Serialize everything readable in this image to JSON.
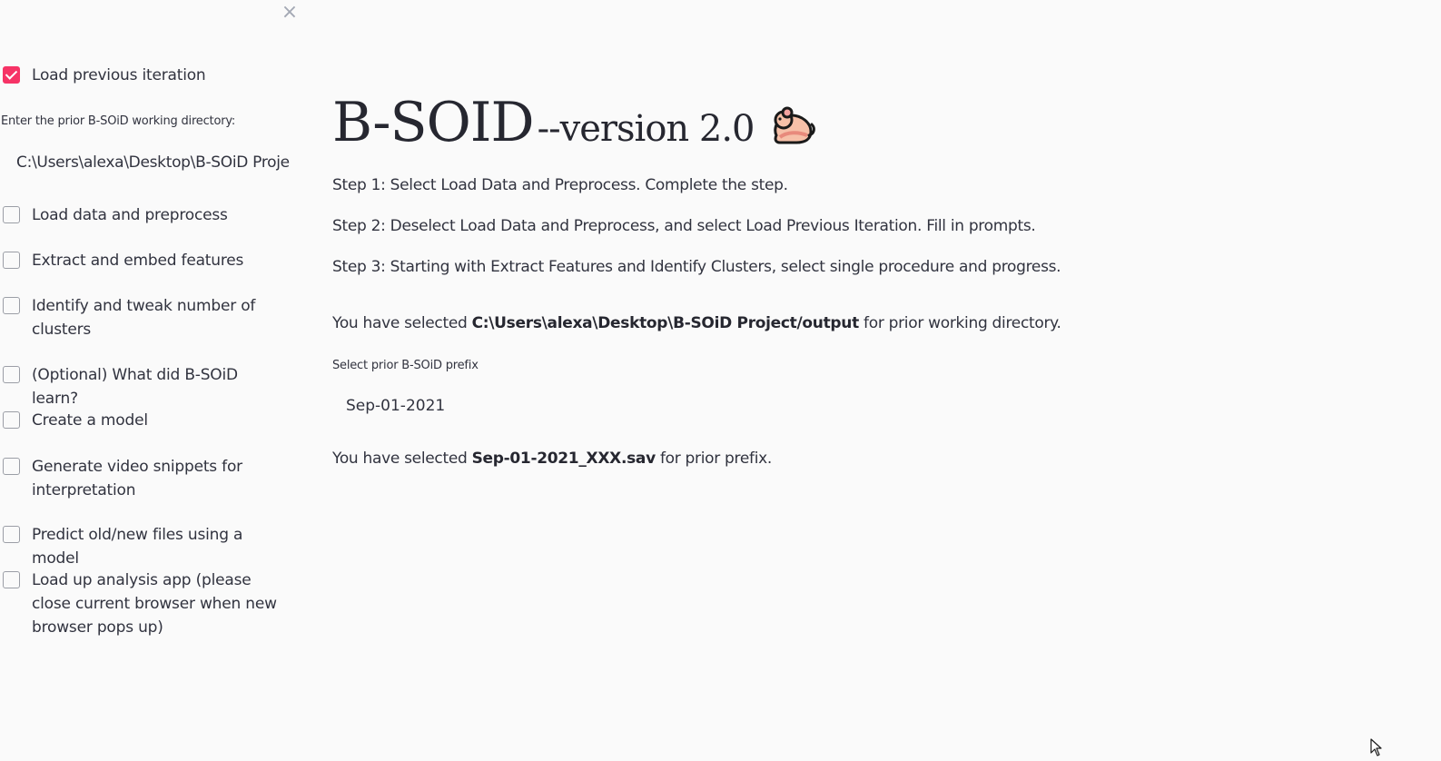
{
  "sidebar": {
    "close_glyph": "×",
    "load_previous": {
      "label": "Load previous iteration",
      "checked": true
    },
    "dir_label": "Enter the prior B-SOiD working directory:",
    "dir_value": "C:\\Users\\alexa\\Desktop\\B-SOiD Proje",
    "items": [
      {
        "label": "Load data and preprocess",
        "checked": false
      },
      {
        "label": "Extract and embed features",
        "checked": false
      },
      {
        "label": "Identify and tweak number of clusters",
        "checked": false
      },
      {
        "label": "(Optional) What did B-SOiD learn?",
        "checked": false
      },
      {
        "label": "Create a model",
        "checked": false
      },
      {
        "label": "Generate video snippets for interpretation",
        "checked": false
      },
      {
        "label": "Predict old/new files using a model",
        "checked": false
      },
      {
        "label": "Load up analysis app (please close current browser when new browser pops up)",
        "checked": false
      }
    ]
  },
  "main": {
    "title": "B-SOID",
    "version": "--version 2.0",
    "title_icon": "mouse-icon",
    "steps": [
      "Step 1: Select Load Data and Preprocess. Complete the step.",
      "Step 2: Deselect Load Data and Preprocess, and select Load Previous Iteration. Fill in prompts.",
      "Step 3: Starting with Extract Features and Identify Clusters, select single procedure and progress."
    ],
    "selected_dir": {
      "prefix": "You have selected ",
      "value": "C:\\Users\\alexa\\Desktop\\B-SOiD Project/output",
      "suffix": " for prior working directory."
    },
    "prefix_label": "Select prior B-SOiD prefix",
    "prefix_value": "Sep-01-2021",
    "selected_prefix": {
      "prefix": "You have selected ",
      "value": "Sep-01-2021_XXX.sav",
      "suffix": " for prior prefix."
    }
  },
  "colors": {
    "accent": "#f63366",
    "background": "#fafafa",
    "text": "#31333f"
  }
}
